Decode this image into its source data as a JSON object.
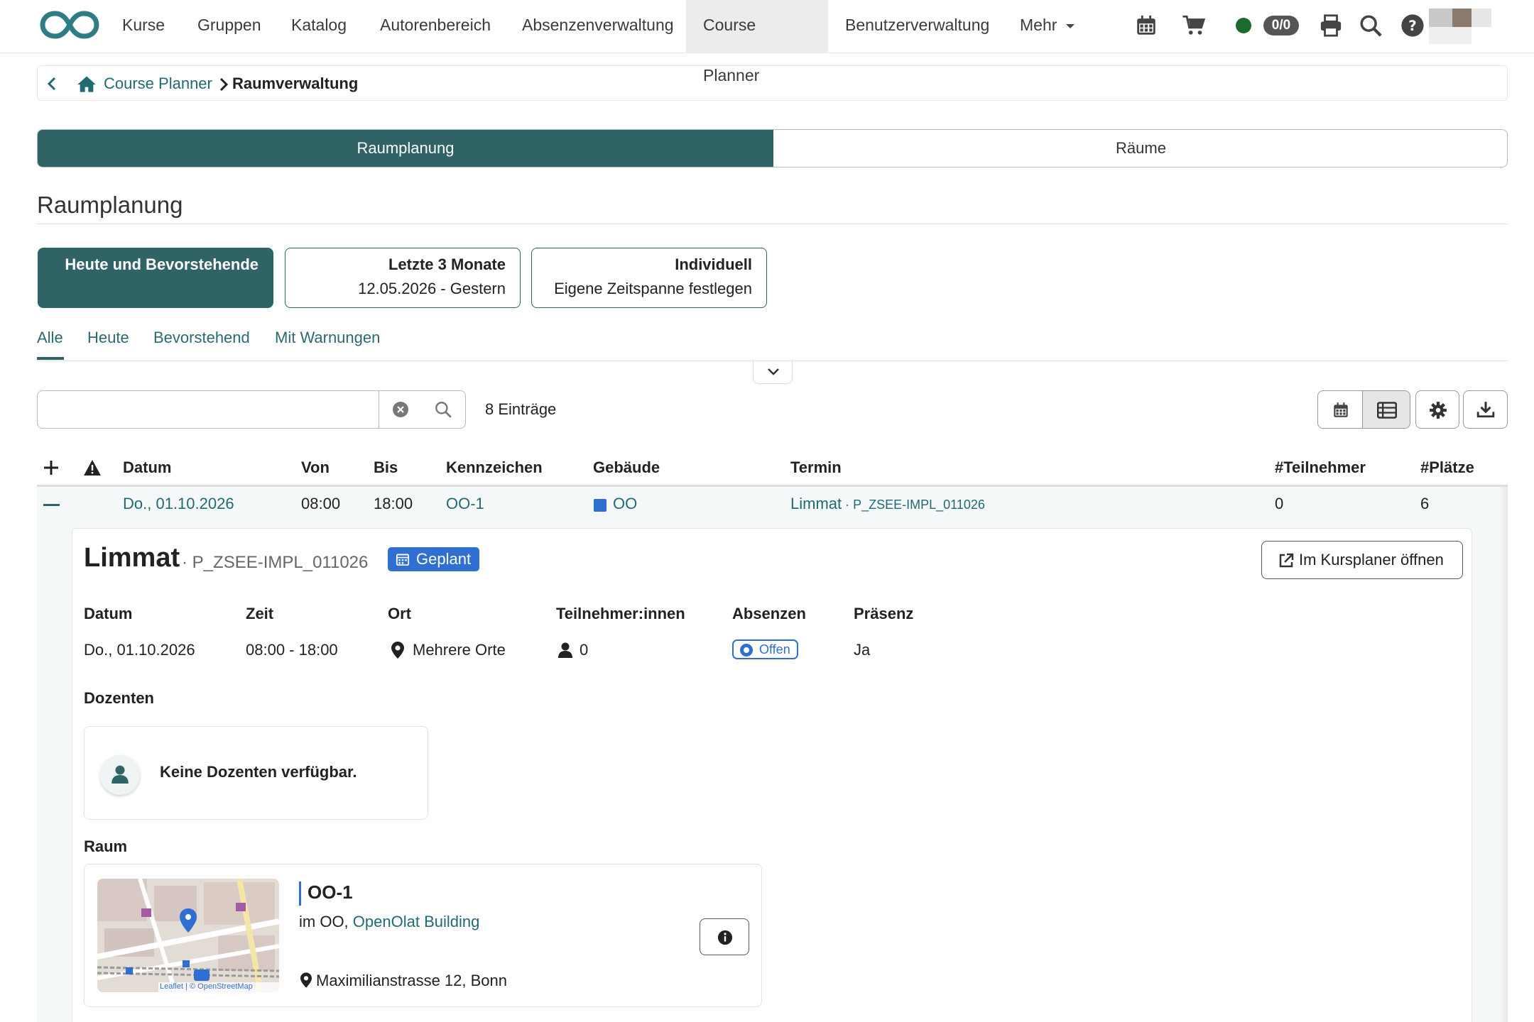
{
  "nav": {
    "items": [
      "Kurse",
      "Gruppen",
      "Katalog",
      "Autorenbereich",
      "Absenzenverwaltung",
      "Course Planner",
      "Benutzerverwaltung",
      "Mehr"
    ],
    "active": "Course Planner",
    "count_badge": "0/0"
  },
  "breadcrumb": {
    "home": "Course Planner",
    "current": "Raumverwaltung"
  },
  "segments": {
    "left": "Raumplanung",
    "right": "Räume"
  },
  "page_title": "Raumplanung",
  "presets": [
    {
      "title": "Heute und Bevorstehende",
      "sub": ""
    },
    {
      "title": "Letzte 3 Monate",
      "sub": "12.05.2026 - Gestern"
    },
    {
      "title": "Individuell",
      "sub": "Eigene Zeitspanne festlegen"
    }
  ],
  "tabs": [
    "Alle",
    "Heute",
    "Bevorstehend",
    "Mit Warnungen"
  ],
  "search": {
    "placeholder": "",
    "entries": "8 Einträge"
  },
  "table": {
    "headers": [
      "Datum",
      "Von",
      "Bis",
      "Kennzeichen",
      "Gebäude",
      "Termin",
      "#Teilnehmer",
      "#Plätze"
    ],
    "row": {
      "datum": "Do., 01.10.2026",
      "von": "08:00",
      "bis": "18:00",
      "kennzeichen": "OO-1",
      "gebaeude": "OO",
      "termin": "Limmat",
      "termin_code": "P_ZSEE-IMPL_011026",
      "teilnehmer": "0",
      "plaetze": "6"
    }
  },
  "detail": {
    "title": "Limmat",
    "code": "P_ZSEE-IMPL_011026",
    "status": "Geplant",
    "open_button": "Im Kursplaner öffnen",
    "labels": [
      "Datum",
      "Zeit",
      "Ort",
      "Teilnehmer:innen",
      "Absenzen",
      "Präsenz"
    ],
    "datum": "Do., 01.10.2026",
    "zeit": "08:00 - 18:00",
    "ort": "Mehrere Orte",
    "teilnehmer": "0",
    "absenzen": "Offen",
    "praesenz": "Ja",
    "dozenten_label": "Dozenten",
    "dozenten_empty": "Keine Dozenten verfügbar.",
    "raum_label": "Raum",
    "room_name": "OO-1",
    "room_in": "im OO,",
    "room_building": "OpenOlat Building",
    "room_address": "Maximilianstrasse 12, Bonn",
    "map_attribution": "Leaflet | © OpenStreetMap"
  },
  "colors": {
    "primary": "#2f6366",
    "link": "#1f6b72",
    "status_blue": "#2f6fd1",
    "online_green": "#1e6b2e"
  }
}
